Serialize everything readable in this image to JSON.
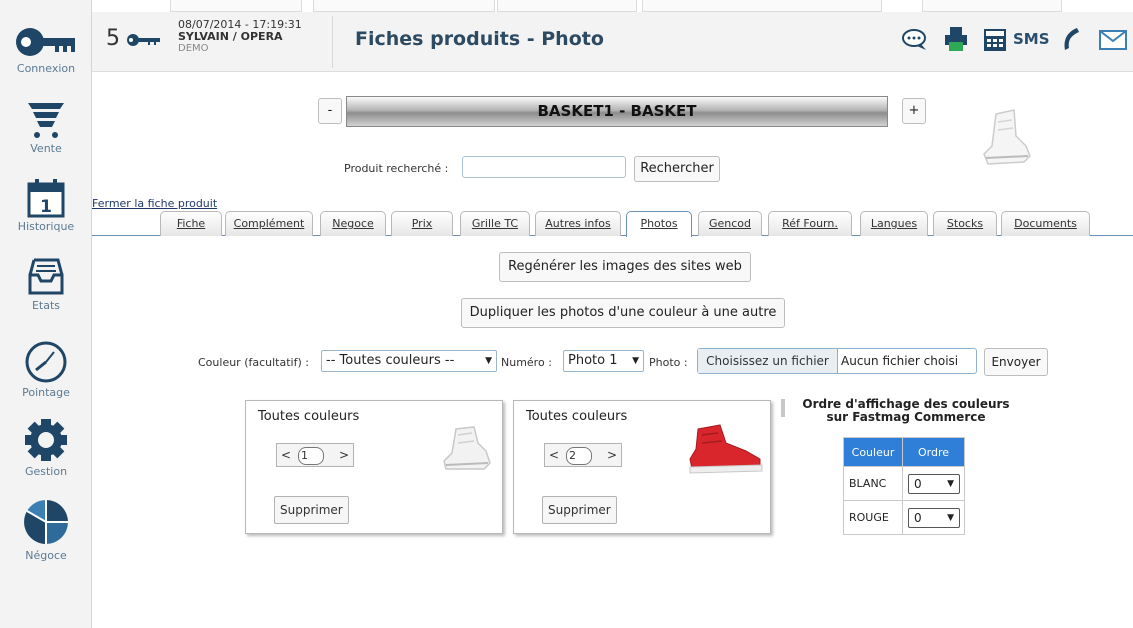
{
  "sidebar": {
    "items": [
      {
        "label": "Connexion",
        "icon": "key-icon"
      },
      {
        "label": "Vente",
        "icon": "cart-icon"
      },
      {
        "label": "Historique",
        "icon": "calendar-icon",
        "badge": "1"
      },
      {
        "label": "Etats",
        "icon": "inbox-tray-icon"
      },
      {
        "label": "Pointage",
        "icon": "clock-icon"
      },
      {
        "label": "Gestion",
        "icon": "gear-icon"
      },
      {
        "label": "Négoce",
        "icon": "pie-chart-icon"
      }
    ]
  },
  "header": {
    "count": "5",
    "datetime": "08/07/2014 - 17:19:31",
    "user": "SYLVAIN / OPERA",
    "environment": "DEMO",
    "title": "Fiches produits - Photo",
    "sms_label": "SMS"
  },
  "product": {
    "prev_label": "-",
    "next_label": "+",
    "name": "BASKET1 - BASKET"
  },
  "search": {
    "label": "Produit recherché :",
    "value": "",
    "button_label": "Rechercher"
  },
  "close_link": "Fermer la fiche produit",
  "tabs": [
    {
      "label": "Fiche"
    },
    {
      "label": "Complément"
    },
    {
      "label": "Negoce"
    },
    {
      "label": "Prix"
    },
    {
      "label": "Grille TC"
    },
    {
      "label": "Autres infos"
    },
    {
      "label": "Photos"
    },
    {
      "label": "Gencod"
    },
    {
      "label": "Réf Fourn."
    },
    {
      "label": "Langues"
    },
    {
      "label": "Stocks"
    },
    {
      "label": "Documents"
    }
  ],
  "active_tab": "Photos",
  "actions": {
    "regenerate_label": "Regénérer les images des sites web",
    "duplicate_label": "Dupliquer les photos d'une couleur à une autre"
  },
  "upload": {
    "color_label": "Couleur (facultatif) :",
    "color_value": "-- Toutes couleurs --",
    "number_label": "Numéro :",
    "number_value": "Photo 1",
    "photo_label": "Photo :",
    "file_button": "Choisissez un fichier",
    "file_status": "Aucun fichier choisi",
    "send_label": "Envoyer"
  },
  "photos": [
    {
      "title": "Toutes couleurs",
      "prev": "<",
      "number": "1",
      "next": ">",
      "delete_label": "Supprimer",
      "shoe_color": "#f2f2f2"
    },
    {
      "title": "Toutes couleurs",
      "prev": "<",
      "number": "2",
      "next": ">",
      "delete_label": "Supprimer",
      "shoe_color": "#d9262c"
    }
  ],
  "order": {
    "title_line1": "Ordre d'affichage des couleurs",
    "title_line2": "sur Fastmag Commerce",
    "col_color": "Couleur",
    "col_order": "Ordre",
    "rows": [
      {
        "color": "BLANC",
        "order": "0"
      },
      {
        "color": "ROUGE",
        "order": "0"
      }
    ]
  },
  "colors": {
    "accent": "#2f7ed8",
    "title": "#2d4a63",
    "sidebar_icon": "#1f4666"
  }
}
